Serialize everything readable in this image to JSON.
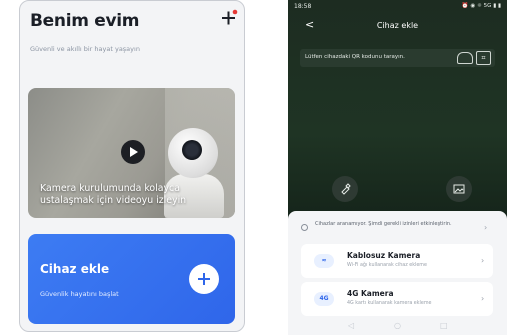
{
  "left": {
    "title": "Benim evim",
    "subtitle": "Güvenli ve akıllı bir hayat yaşayın",
    "video_caption": "Kamera kurulumunda kolayca ustalaşmak için videoyu izleyin",
    "card": {
      "title": "Cihaz ekle",
      "subtitle": "Güvenlik hayatını başlat"
    },
    "colors": {
      "accent": "#2f66ea",
      "badge": "#e53935"
    }
  },
  "right": {
    "status": {
      "time": "18:58",
      "icons": "⏰ ◉ ☼ 5G ▮ ▮"
    },
    "back_glyph": "<",
    "title": "Cihaz ekle",
    "qr_hint": "Lütfen cihazdaki QR kodunu tarayın.",
    "notice": "Cihazlar aranamıyor. Şimdi gerekli izinleri etkinleştirin.",
    "items": [
      {
        "icon_text": "≈",
        "icon": "wifi-icon",
        "name": "Kablosuz Kamera",
        "desc": "Wi-Fi ağı kullanarak cihaz ekleme"
      },
      {
        "icon_text": "4G",
        "icon": "4g-icon",
        "name": "4G Kamera",
        "desc": "4G kartı kullanarak kamera ekleme"
      }
    ],
    "nav": {
      "back": "◁",
      "home": "○",
      "recent": "□"
    }
  }
}
